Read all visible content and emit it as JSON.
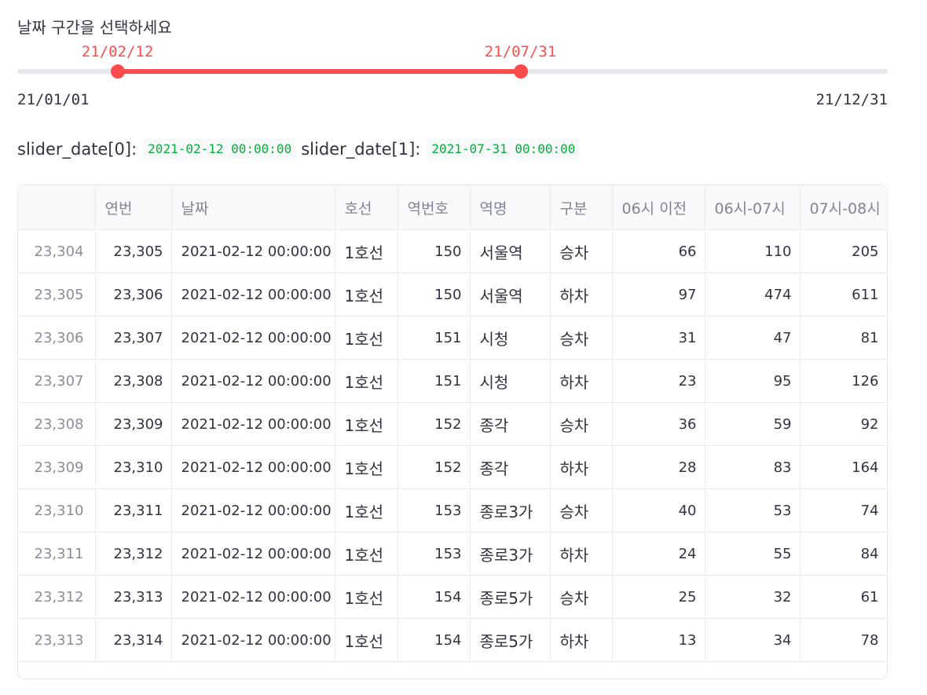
{
  "slider": {
    "label": "날짜 구간을 선택하세요",
    "min_label": "21/01/01",
    "max_label": "21/12/31",
    "start_label": "21/02/12",
    "end_label": "21/07/31",
    "start_fraction": 0.1151,
    "end_fraction": 0.5781,
    "accent_color": "#ff4b4b"
  },
  "output": {
    "key0": "slider_date[0]:",
    "value0": "2021-02-12 00:00:00",
    "key1": "slider_date[1]:",
    "value1": "2021-07-31 00:00:00"
  },
  "table": {
    "columns": [
      "",
      "연번",
      "날짜",
      "호선",
      "역번호",
      "역명",
      "구분",
      "06시 이전",
      "06시-07시",
      "07시-08시"
    ],
    "rows": [
      [
        "23,304",
        "23,305",
        "2021-02-12 00:00:00",
        "1호선",
        "150",
        "서울역",
        "승차",
        "66",
        "110",
        "205"
      ],
      [
        "23,305",
        "23,306",
        "2021-02-12 00:00:00",
        "1호선",
        "150",
        "서울역",
        "하차",
        "97",
        "474",
        "611"
      ],
      [
        "23,306",
        "23,307",
        "2021-02-12 00:00:00",
        "1호선",
        "151",
        "시청",
        "승차",
        "31",
        "47",
        "81"
      ],
      [
        "23,307",
        "23,308",
        "2021-02-12 00:00:00",
        "1호선",
        "151",
        "시청",
        "하차",
        "23",
        "95",
        "126"
      ],
      [
        "23,308",
        "23,309",
        "2021-02-12 00:00:00",
        "1호선",
        "152",
        "종각",
        "승차",
        "36",
        "59",
        "92"
      ],
      [
        "23,309",
        "23,310",
        "2021-02-12 00:00:00",
        "1호선",
        "152",
        "종각",
        "하차",
        "28",
        "83",
        "164"
      ],
      [
        "23,310",
        "23,311",
        "2021-02-12 00:00:00",
        "1호선",
        "153",
        "종로3가",
        "승차",
        "40",
        "53",
        "74"
      ],
      [
        "23,311",
        "23,312",
        "2021-02-12 00:00:00",
        "1호선",
        "153",
        "종로3가",
        "하차",
        "24",
        "55",
        "84"
      ],
      [
        "23,312",
        "23,313",
        "2021-02-12 00:00:00",
        "1호선",
        "154",
        "종로5가",
        "승차",
        "25",
        "32",
        "61"
      ],
      [
        "23,313",
        "23,314",
        "2021-02-12 00:00:00",
        "1호선",
        "154",
        "종로5가",
        "하차",
        "13",
        "34",
        "78"
      ]
    ]
  }
}
